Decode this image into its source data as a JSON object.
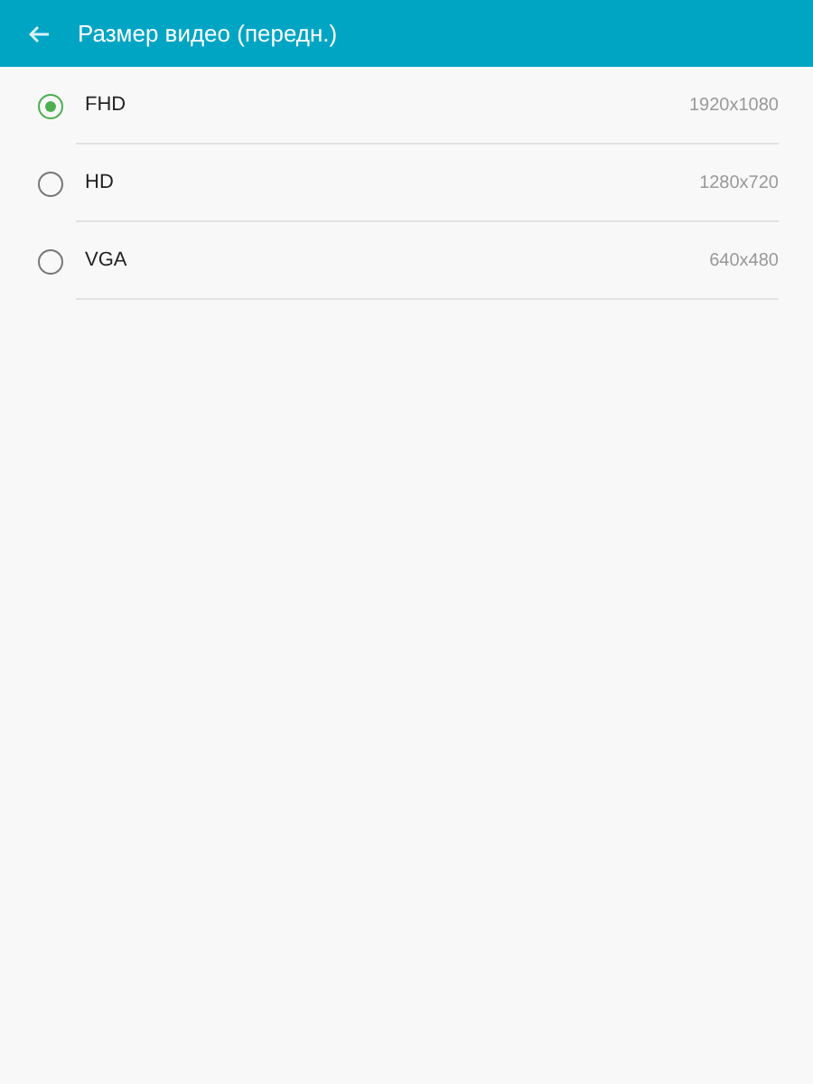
{
  "header": {
    "title": "Размер видео (передн.)"
  },
  "options": [
    {
      "label": "FHD",
      "value": "1920x1080",
      "selected": true
    },
    {
      "label": "HD",
      "value": "1280x720",
      "selected": false
    },
    {
      "label": "VGA",
      "value": "640x480",
      "selected": false
    }
  ]
}
